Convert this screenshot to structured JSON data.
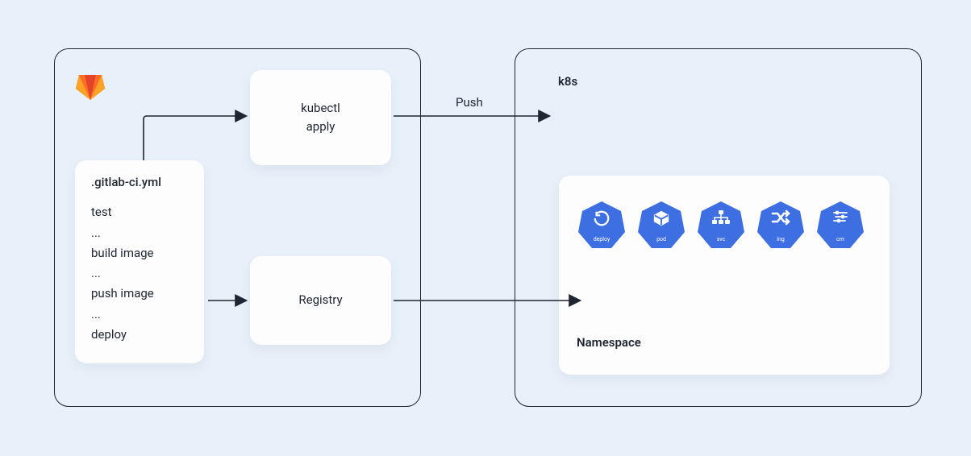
{
  "gitlab": {
    "ci_file": ".gitlab-ci.yml",
    "steps": [
      "test",
      "...",
      "build image",
      "...",
      "push image",
      "...",
      "deploy"
    ],
    "kubectl_label_1": "kubectl",
    "kubectl_label_2": "apply",
    "registry_label": "Registry"
  },
  "connection": {
    "push_label": "Push"
  },
  "k8s": {
    "title": "k8s",
    "namespace_label": "Namespace",
    "resources": [
      {
        "key": "deploy",
        "label": "deploy"
      },
      {
        "key": "pod",
        "label": "pod"
      },
      {
        "key": "svc",
        "label": "svc"
      },
      {
        "key": "ing",
        "label": "ing"
      },
      {
        "key": "cm",
        "label": "cm"
      }
    ]
  }
}
